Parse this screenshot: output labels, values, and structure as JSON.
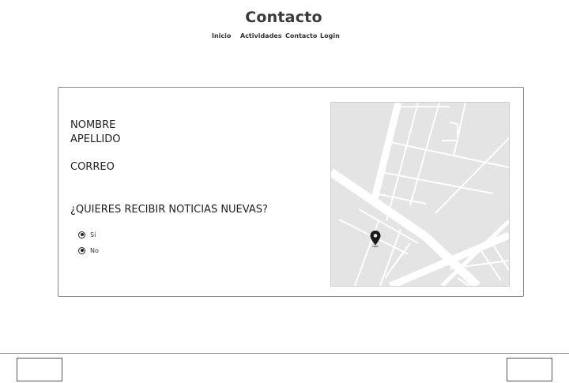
{
  "header": {
    "title": "Contacto",
    "nav": [
      "Inicio",
      "Actividades",
      "Contacto",
      "Login"
    ]
  },
  "form": {
    "name_label": "NOMBRE",
    "surname_label": "APELLIDO",
    "email_label": "CORREO",
    "newsletter_question": "¿QUIERES RECIBIR NOTICIAS NUEVAS?",
    "options": [
      "Sí",
      "No"
    ]
  },
  "map": {
    "icon": "map-pin-icon"
  },
  "colors": {
    "map_background": "#e4e4e4",
    "map_roads": "#ffffff",
    "pin": "#1a1a1a"
  }
}
